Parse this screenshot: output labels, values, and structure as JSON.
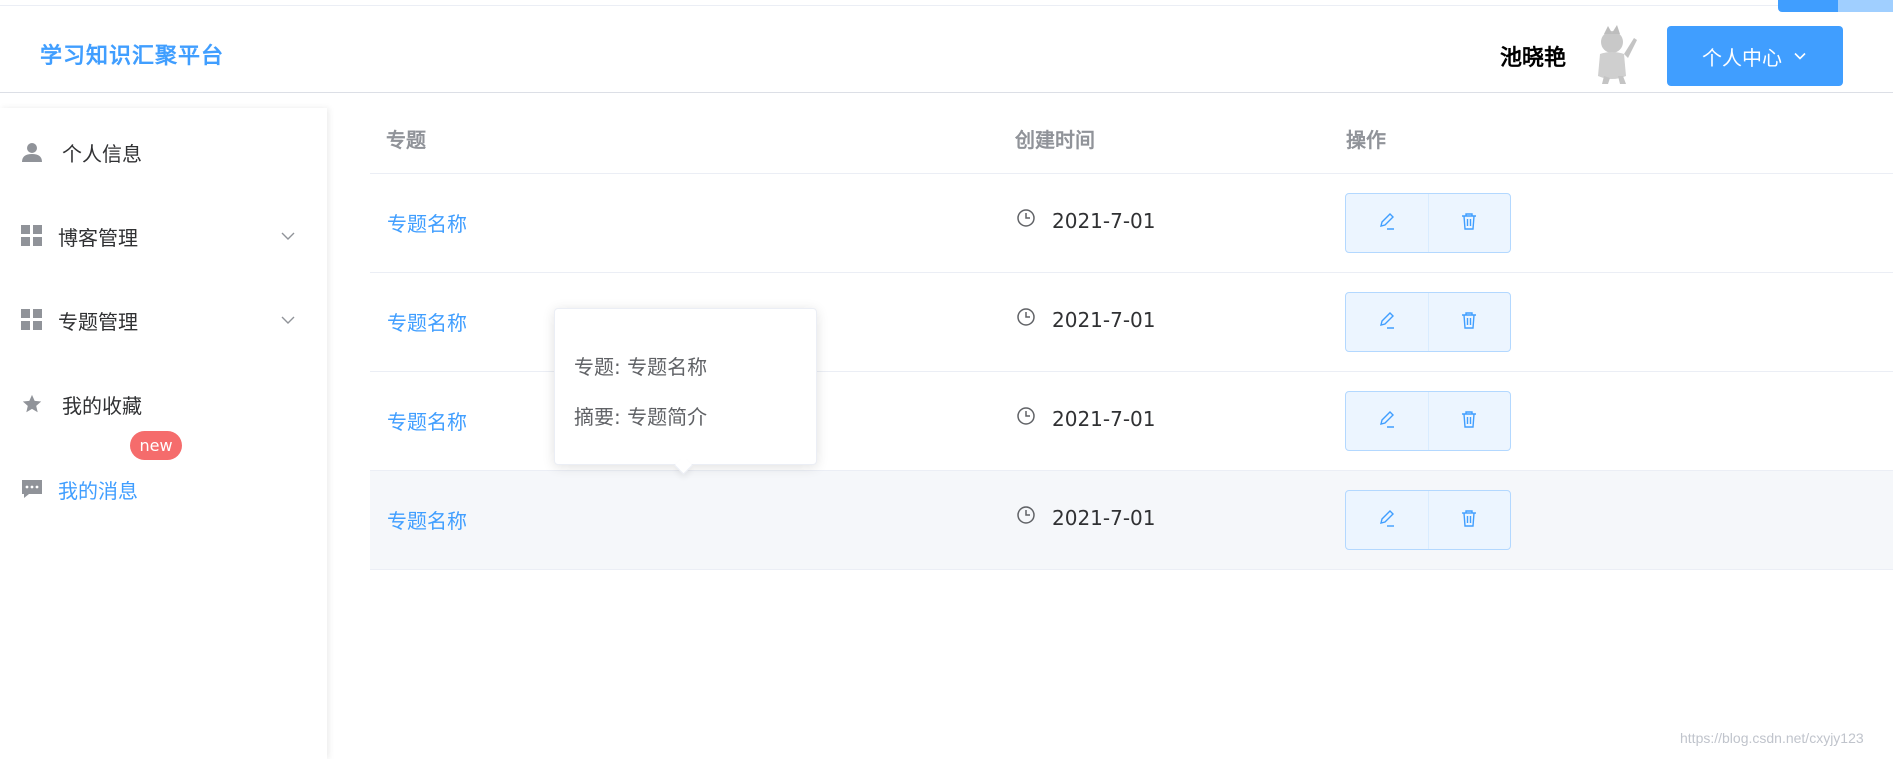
{
  "header": {
    "brand": "学习知识汇聚平台",
    "user_name": "池晓艳",
    "center_button": "个人中心"
  },
  "sidebar": {
    "items": [
      {
        "label": "个人信息",
        "icon": "user-icon"
      },
      {
        "label": "博客管理",
        "icon": "grid-icon"
      },
      {
        "label": "专题管理",
        "icon": "grid-icon"
      },
      {
        "label": "我的收藏",
        "icon": "star-icon"
      },
      {
        "label": "我的消息",
        "icon": "chat-icon",
        "active": true
      }
    ],
    "badge": "new"
  },
  "table": {
    "headers": [
      "专题",
      "创建时间",
      "操作"
    ],
    "rows": [
      {
        "topic": "专题名称",
        "date": "2021-7-01"
      },
      {
        "topic": "专题名称",
        "date": "2021-7-01"
      },
      {
        "topic": "专题名称",
        "date": "2021-7-01"
      },
      {
        "topic": "专题名称",
        "date": "2021-7-01"
      }
    ]
  },
  "popover": {
    "line1": "专题: 专题名称",
    "line2": "摘要: 专题简介"
  },
  "watermark": "https://blog.csdn.net/cxyjy123",
  "colors": {
    "primary": "#409eff",
    "badge": "#f56c6c",
    "text": "#303133",
    "muted": "#909399"
  }
}
